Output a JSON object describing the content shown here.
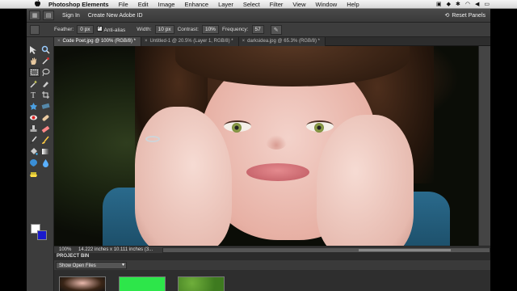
{
  "menubar": {
    "apple": "",
    "app_name": "Photoshop Elements",
    "items": [
      "File",
      "Edit",
      "Image",
      "Enhance",
      "Layer",
      "Select",
      "Filter",
      "View",
      "Window",
      "Help"
    ]
  },
  "appbar": {
    "sign_in": "Sign In",
    "create_id": "Create New Adobe ID",
    "reset_panels": "Reset Panels"
  },
  "options": {
    "feather_label": "Feather:",
    "feather_value": "0 px",
    "antialias_label": "Anti-alias",
    "width_label": "Width:",
    "width_value": "10 px",
    "contrast_label": "Contrast:",
    "contrast_value": "10%",
    "frequency_label": "Frequency:",
    "frequency_value": "57"
  },
  "tabs": [
    {
      "label": "Code Poet.jpg @ 100% (RGB/8) *",
      "active": true
    },
    {
      "label": "Untitled-1 @ 20.5% (Layer 1, RGB/8) *",
      "active": false
    },
    {
      "label": "darksidea.jpg @ 65.3% (RGB/8) *",
      "active": false
    }
  ],
  "status": {
    "zoom": "100%",
    "info": "14.222 inches x 10.111 inches (3..."
  },
  "bin": {
    "title": "PROJECT BIN",
    "select_value": "Show Open Files"
  },
  "colors": {
    "foreground": "#ffffff",
    "background": "#1a1acc"
  }
}
